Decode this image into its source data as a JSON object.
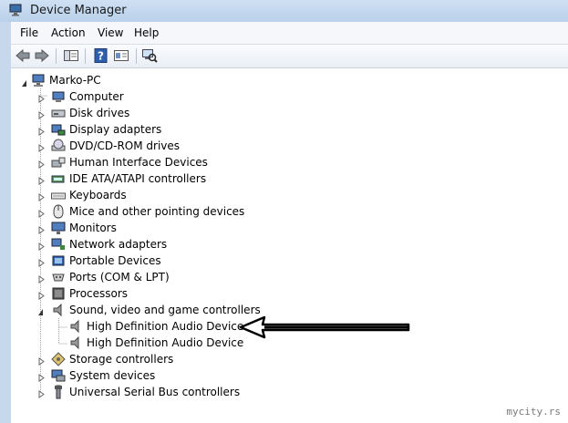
{
  "window": {
    "title": "Device Manager"
  },
  "menu": [
    "File",
    "Action",
    "View",
    "Help"
  ],
  "tree": {
    "root": "Marko-PC",
    "categories": [
      "Computer",
      "Disk drives",
      "Display adapters",
      "DVD/CD-ROM drives",
      "Human Interface Devices",
      "IDE ATA/ATAPI controllers",
      "Keyboards",
      "Mice and other pointing devices",
      "Monitors",
      "Network adapters",
      "Portable Devices",
      "Ports (COM & LPT)",
      "Processors",
      "Sound, video and game controllers",
      "Storage controllers",
      "System devices",
      "Universal Serial Bus controllers"
    ],
    "sound_children": [
      "High Definition Audio Device",
      "High Definition Audio Device"
    ]
  },
  "watermark": "mycity.rs",
  "colors": {
    "titlebar": "#b9d1ea",
    "arrow": "#000000",
    "selection_frame": "#c7d8ec"
  }
}
